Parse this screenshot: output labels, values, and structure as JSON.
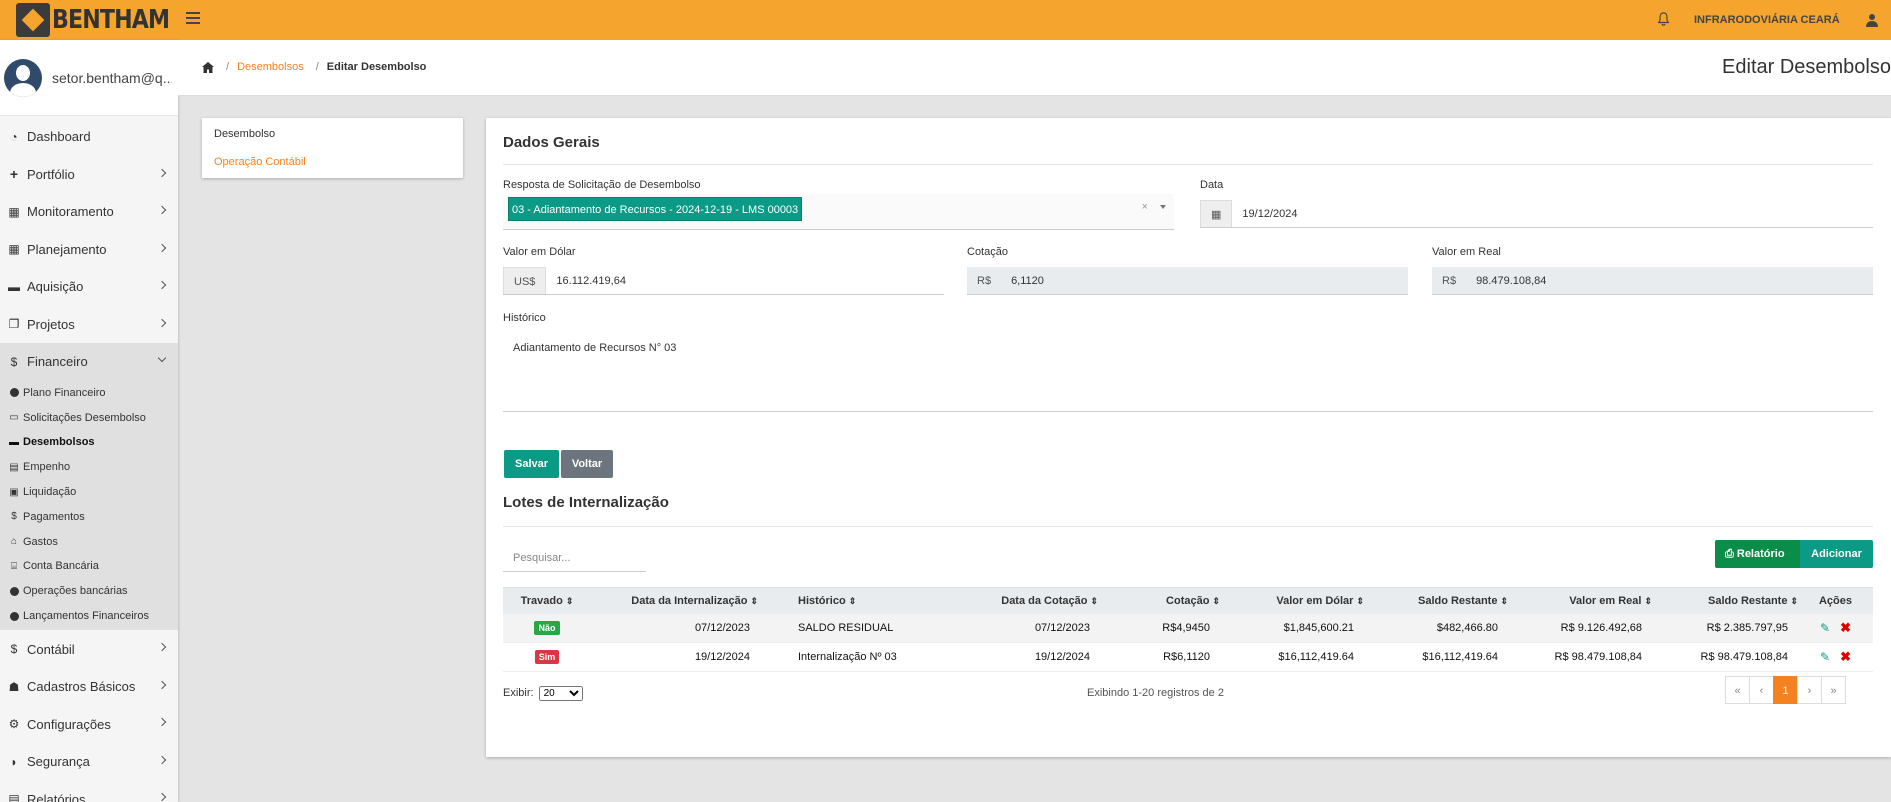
{
  "app": {
    "brand": "BENTHAM",
    "company": "INFRARODOVIÁRIA CEARÁ"
  },
  "user": {
    "email": "setor.bentham@q..."
  },
  "sidebar": {
    "items": [
      {
        "label": "Dashboard",
        "icon": "dashboard-icon"
      },
      {
        "label": "Portfólio",
        "icon": "plus-icon"
      },
      {
        "label": "Monitoramento",
        "icon": "calendar-icon"
      },
      {
        "label": "Planejamento",
        "icon": "calendar-icon"
      },
      {
        "label": "Aquisição",
        "icon": "card-icon"
      },
      {
        "label": "Projetos",
        "icon": "copy-icon"
      },
      {
        "label": "Financeiro",
        "icon": "dollar-icon"
      }
    ],
    "financeiro_sub": [
      {
        "label": "Plano Financeiro",
        "icon": "circle-icon"
      },
      {
        "label": "Solicitações Desembolso",
        "icon": "card-icon"
      },
      {
        "label": "Desembolsos",
        "icon": "card-icon"
      },
      {
        "label": "Empenho",
        "icon": "file-icon"
      },
      {
        "label": "Liquidação",
        "icon": "money-icon"
      },
      {
        "label": "Pagamentos",
        "icon": "dollar-icon"
      },
      {
        "label": "Gastos",
        "icon": "basket-icon"
      },
      {
        "label": "Conta Bancária",
        "icon": "bank-icon"
      },
      {
        "label": "Operações bancárias",
        "icon": "circle-icon"
      },
      {
        "label": "Lançamentos Financeiros",
        "icon": "circle-icon"
      }
    ],
    "items_after": [
      {
        "label": "Contábil",
        "icon": "dollar-icon"
      },
      {
        "label": "Cadastros Básicos",
        "icon": "users-icon"
      },
      {
        "label": "Configurações",
        "icon": "gears-icon"
      },
      {
        "label": "Segurança",
        "icon": "shield-icon"
      },
      {
        "label": "Relatórios",
        "icon": "file-icon"
      }
    ]
  },
  "breadcrumb": {
    "parent": "Desembolsos",
    "current": "Editar Desembolso"
  },
  "page_title": "Editar Desembolso",
  "left_menu": {
    "item1": "Desembolso",
    "item2": "Operação Contábil"
  },
  "form": {
    "section_title": "Dados Gerais",
    "resposta_label": "Resposta de Solicitação de Desembolso",
    "resposta_value": "03 - Adiantamento de Recursos - 2024-12-19 - LMS 00003",
    "data_label": "Data",
    "data_value": "19/12/2024",
    "dolar_label": "Valor em Dólar",
    "dolar_prefix": "US$",
    "dolar_value": "16.112.419,64",
    "cotacao_label": "Cotação",
    "cotacao_prefix": "R$",
    "cotacao_value": "6,1120",
    "real_label": "Valor em Real",
    "real_prefix": "R$",
    "real_value": "98.479.108,84",
    "historico_label": "Histórico",
    "historico_value": "Adiantamento de Recursos N° 03",
    "save": "Salvar",
    "back": "Voltar"
  },
  "lotes": {
    "title": "Lotes de Internalização",
    "search_placeholder": "Pesquisar...",
    "relatorio": "Relatório",
    "adicionar": "Adicionar",
    "headers": [
      "Travado",
      "Data da Internalização",
      "Histórico",
      "Data da Cotação",
      "Cotação",
      "Valor em Dólar",
      "Saldo Restante",
      "Valor em Real",
      "Saldo Restante",
      "Ações"
    ],
    "rows": [
      {
        "travado": "Não",
        "data_int": "07/12/2023",
        "historico": "SALDO RESIDUAL",
        "data_cot": "07/12/2023",
        "cotacao": "R$4,9450",
        "dolar": "$1,845,600.21",
        "saldo_usd": "$482,466.80",
        "real": "R$ 9.126.492,68",
        "saldo_brl": "R$ 2.385.797,95"
      },
      {
        "travado": "Sim",
        "data_int": "19/12/2024",
        "historico": "Internalização Nº 03",
        "data_cot": "19/12/2024",
        "cotacao": "R$6,1120",
        "dolar": "$16,112,419.64",
        "saldo_usd": "$16,112,419.64",
        "real": "R$ 98.479.108,84",
        "saldo_brl": "R$ 98.479.108,84"
      }
    ],
    "exibir_label": "Exibir:",
    "page_size": "20",
    "showing": "Exibindo 1-20 registros de 2",
    "pager": [
      "«",
      "‹",
      "1",
      "›",
      "»"
    ]
  },
  "colors": {
    "brand": "#f5a52d",
    "accent": "#f58220",
    "primary": "#0a9a86"
  }
}
